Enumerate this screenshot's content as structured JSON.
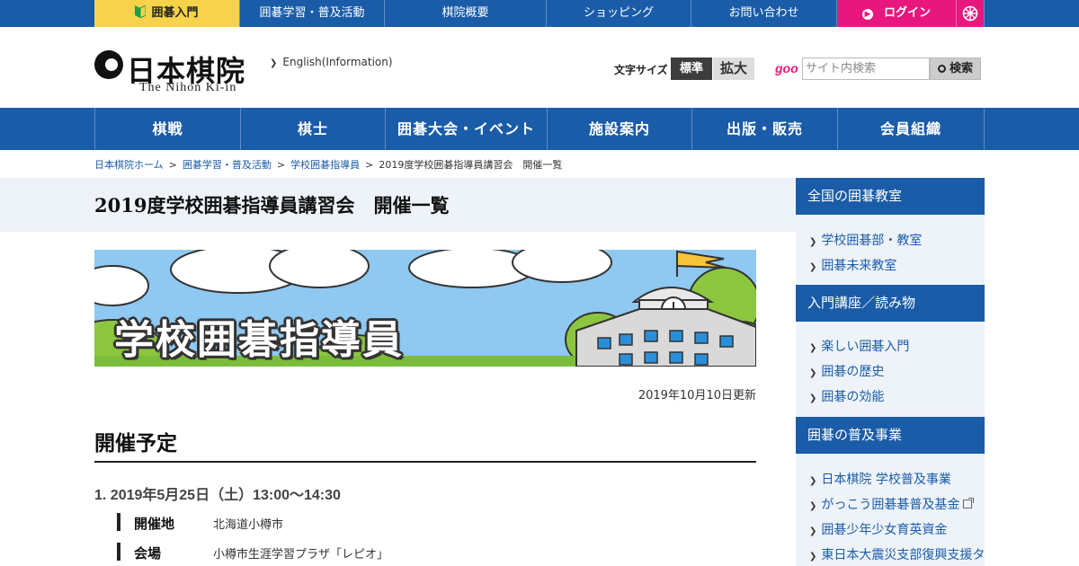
{
  "topbar": {
    "nyumon": "囲碁入門",
    "items": [
      "囲碁学習・普及活動",
      "棋院概要",
      "ショッピング",
      "お問い合わせ"
    ],
    "login": "ログイン"
  },
  "header": {
    "logo_text": "日本棋院",
    "logo_sub": "The Nihon Ki-in",
    "english_link": "English(Information)",
    "font_size_label": "文字サイズ",
    "font_std": "標準",
    "font_big": "拡大",
    "goo": "goo",
    "search_placeholder": "サイト内検索",
    "search_button": "検索"
  },
  "mainnav": [
    "棋戦",
    "棋士",
    "囲碁大会・イベント",
    "施設案内",
    "出版・販売",
    "会員組織"
  ],
  "breadcrumb": {
    "items": [
      "日本棋院ホーム",
      "囲碁学習・普及活動",
      "学校囲碁指導員"
    ],
    "current": "2019度学校囲碁指導員講習会　開催一覧"
  },
  "page": {
    "title": "2019度学校囲碁指導員講習会　開催一覧",
    "banner_text": "学校囲碁指導員",
    "updated": "2019年10月10日更新",
    "section_heading": "開催予定",
    "event": {
      "date": "1. 2019年5月25日（土）13:00～14:30",
      "rows": [
        {
          "label": "開催地",
          "value": "北海道小樽市"
        },
        {
          "label": "会場",
          "value": "小樽市生涯学習プラザ「レピオ」"
        }
      ]
    }
  },
  "sidebar": [
    {
      "heading": "全国の囲碁教室",
      "items": [
        "学校囲碁部・教室",
        "囲碁未来教室"
      ]
    },
    {
      "heading": "入門講座／読み物",
      "items": [
        "楽しい囲碁入門",
        "囲碁の歴史",
        "囲碁の効能"
      ]
    },
    {
      "heading": "囲碁の普及事業",
      "items": [
        "日本棋院 学校普及事業",
        "がっこう囲碁碁普及基金",
        "囲碁少年少女育英資金",
        "東日本大震災支部復興支援タ"
      ]
    }
  ],
  "colors": {
    "brand_blue": "#1a5ca8",
    "login_pink": "#e8177e",
    "nyumon_yellow": "#f6d34a"
  }
}
